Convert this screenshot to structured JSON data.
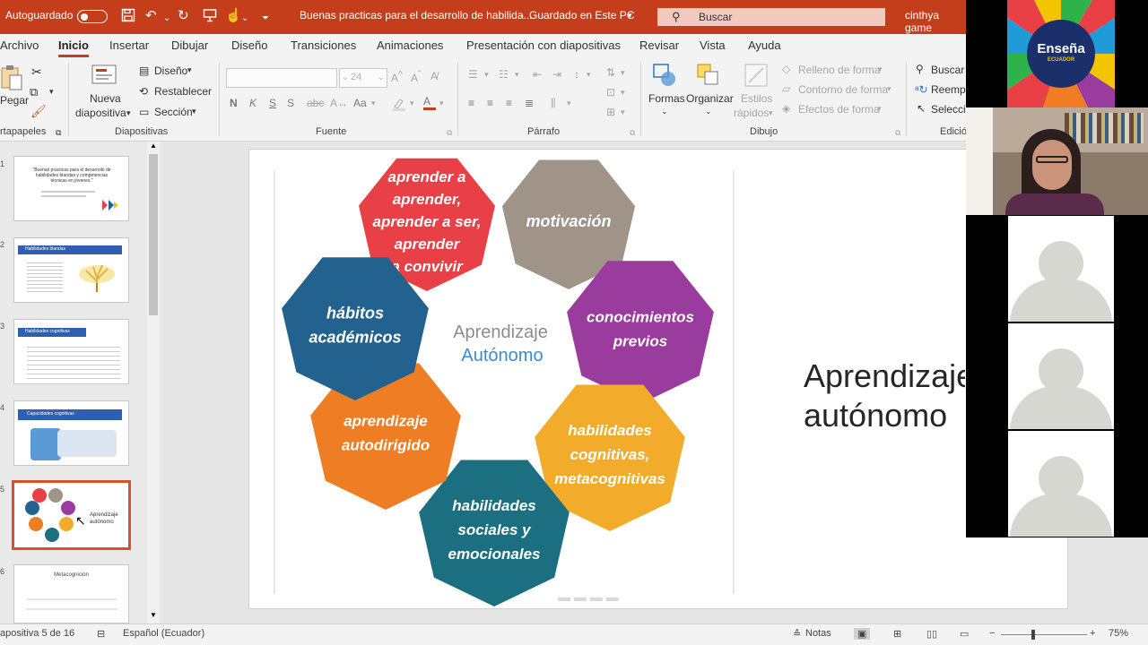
{
  "titlebar": {
    "autosave_label": "Autoguardado",
    "doc_title": "Buenas practicas para el desarrollo de habilida...",
    "save_status": "Guardado en Este PC",
    "search_placeholder": "Buscar",
    "user": "cinthya game"
  },
  "tabs": [
    "Archivo",
    "Inicio",
    "Insertar",
    "Dibujar",
    "Diseño",
    "Transiciones",
    "Animaciones",
    "Presentación con diapositivas",
    "Revisar",
    "Vista",
    "Ayuda"
  ],
  "ribbon": {
    "clipboard": {
      "paste_label": "Pegar",
      "group": "rtapapeles"
    },
    "slides": {
      "new_slide_line1": "Nueva",
      "new_slide_line2": "diapositiva",
      "layout": "Diseño",
      "reset": "Restablecer",
      "section": "Sección",
      "group": "Diapositivas"
    },
    "font": {
      "size": "24",
      "bold": "N",
      "italic": "K",
      "underline": "S",
      "strike": "S",
      "case": "Aa",
      "group": "Fuente"
    },
    "paragraph": {
      "group": "Párrafo"
    },
    "drawing": {
      "shapes": "Formas",
      "arrange": "Organizar",
      "quick_styles_line1": "Estilos",
      "quick_styles_line2": "rápidos",
      "fill": "Relleno de forma",
      "outline": "Contorno de forma",
      "effects": "Efectos de forma",
      "group": "Dibujo"
    },
    "editing": {
      "find": "Buscar",
      "replace": "Reempl",
      "select": "Seleccio",
      "group": "Edició"
    }
  },
  "thumbnails": [
    {
      "num": "1",
      "title": "\"Buenas practicas para el desarrollo de habilidades blandas y competencias técnicas en jóvenes.\""
    },
    {
      "num": "2",
      "title": "Habilidades blandas"
    },
    {
      "num": "3",
      "title": "Habilidades cognitivas"
    },
    {
      "num": "4",
      "title": "Capacidades cognitivas"
    },
    {
      "num": "5",
      "title": "Aprendizaje autónomo"
    },
    {
      "num": "6",
      "title": "Metacognición"
    }
  ],
  "slide": {
    "center_line1": "Aprendizaje",
    "center_line2": "Autónomo",
    "title_line1": "Aprendizaje",
    "title_line2": "autónomo",
    "heptagons": [
      {
        "lines": [
          "aprender a",
          "aprender,",
          "aprender a ser,",
          "aprender",
          "a convivir"
        ],
        "color": "#e84046"
      },
      {
        "lines": [
          "motivación"
        ],
        "color": "#a09489"
      },
      {
        "lines": [
          "conocimientos",
          "previos"
        ],
        "color": "#9a3b9e"
      },
      {
        "lines": [
          "habilidades",
          "cognitivas,",
          "metacognitivas"
        ],
        "color": "#f2ab2b"
      },
      {
        "lines": [
          "habilidades",
          "sociales y",
          "emocionales"
        ],
        "color": "#1b6f80"
      },
      {
        "lines": [
          "aprendizaje",
          "autodirigido"
        ],
        "color": "#ef7d24"
      },
      {
        "lines": [
          "hábitos",
          "académicos"
        ],
        "color": "#23628e"
      }
    ]
  },
  "video": {
    "logo_line1": "Enseña",
    "logo_line2": "ECUADOR"
  },
  "statusbar": {
    "slide_info": "apositiva 5 de 16",
    "language": "Español (Ecuador)",
    "notes": "Notas",
    "zoom": "75%"
  }
}
